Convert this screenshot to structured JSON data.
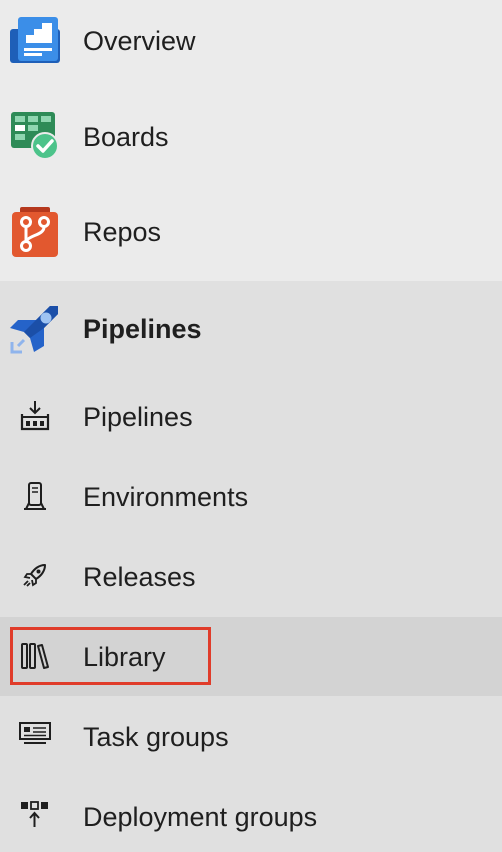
{
  "nav": {
    "top_items": [
      {
        "label": "Overview",
        "icon": "overview-icon",
        "color": "#2f7bd6"
      },
      {
        "label": "Boards",
        "icon": "boards-icon",
        "color": "#2e8b57"
      },
      {
        "label": "Repos",
        "icon": "repos-icon",
        "color": "#d9532c"
      }
    ],
    "pipelines_group": {
      "label": "Pipelines",
      "icon": "pipelines-rocket-icon",
      "color": "#2563c9",
      "sub_items": [
        {
          "label": "Pipelines",
          "icon": "pipelines-icon"
        },
        {
          "label": "Environments",
          "icon": "environments-icon"
        },
        {
          "label": "Releases",
          "icon": "releases-icon"
        },
        {
          "label": "Library",
          "icon": "library-icon",
          "selected": true
        },
        {
          "label": "Task groups",
          "icon": "task-groups-icon"
        },
        {
          "label": "Deployment groups",
          "icon": "deployment-groups-icon"
        }
      ]
    }
  },
  "colors": {
    "top_bg": "#ebebeb",
    "group_bg": "#e0e0e0",
    "selected_bg": "#d3d3d3",
    "highlight_border": "#e03c2a"
  }
}
